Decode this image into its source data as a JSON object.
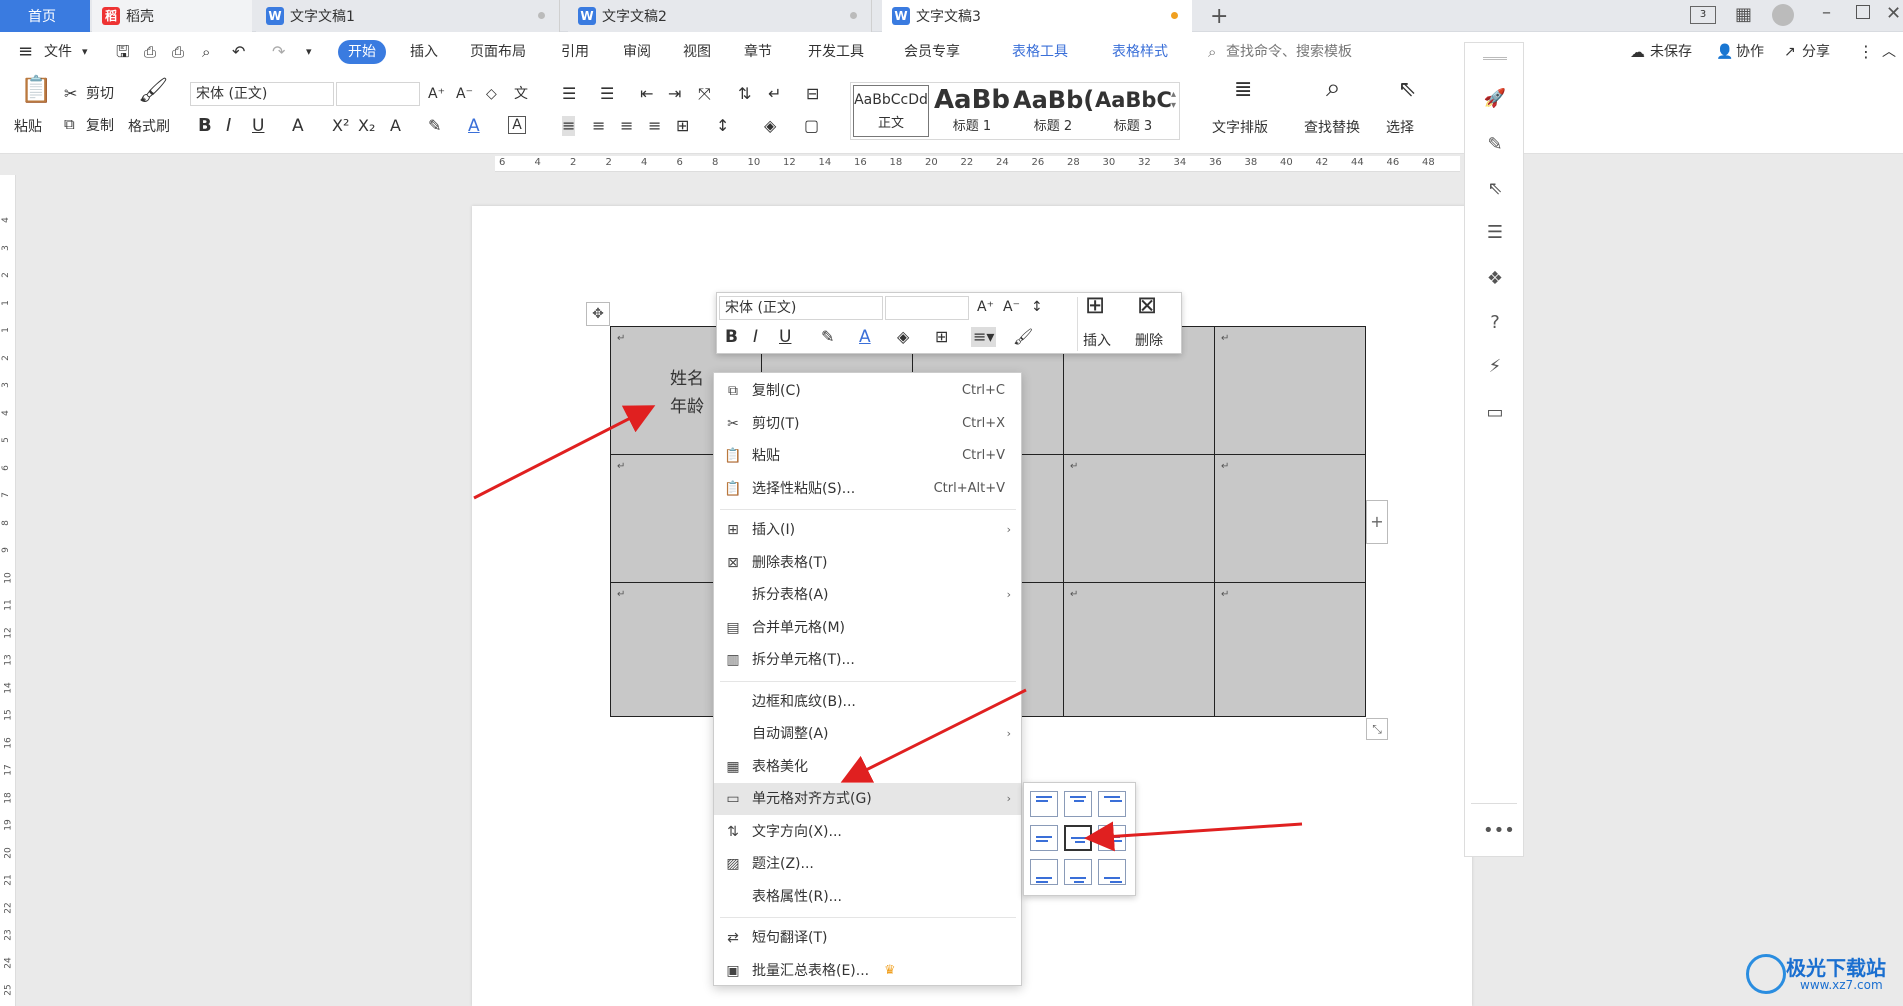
{
  "tabs": [
    {
      "label": "首页",
      "active": true
    },
    {
      "label": "稻壳"
    },
    {
      "label": "文字文稿1"
    },
    {
      "label": "文字文稿2"
    },
    {
      "label": "文字文稿3"
    }
  ],
  "new_tab": "+",
  "menu": {
    "file": "文件",
    "items": [
      "开始",
      "插入",
      "页面布局",
      "引用",
      "审阅",
      "视图",
      "章节",
      "开发工具",
      "会员专享"
    ],
    "table_tools": "表格工具",
    "table_style": "表格样式",
    "search": "查找命令、搜索模板",
    "unsaved": "未保存",
    "collab": "协作",
    "share": "分享"
  },
  "toolbar": {
    "paste": "粘贴",
    "cut": "剪切",
    "copy": "复制",
    "format_painter": "格式刷",
    "font": "宋体 (正文)",
    "font_size": "",
    "styles": [
      {
        "preview": "AaBbCcDd",
        "name": "正文"
      },
      {
        "preview": "AaBb",
        "name": "标题 1"
      },
      {
        "preview": "AaBb(",
        "name": "标题 2"
      },
      {
        "preview": "AaBbC",
        "name": "标题 3"
      }
    ],
    "text_layout": "文字排版",
    "find_replace": "查找替换",
    "select": "选择"
  },
  "ruler_labels": [
    "6",
    "4",
    "2",
    "2",
    "4",
    "6",
    "8",
    "10",
    "12",
    "14",
    "16",
    "18",
    "20",
    "22",
    "24",
    "26",
    "28",
    "30",
    "32",
    "34",
    "36",
    "38",
    "40",
    "42",
    "44",
    "46",
    "48"
  ],
  "vruler_labels": [
    "4",
    "3",
    "2",
    "1",
    "1",
    "2",
    "3",
    "4",
    "5",
    "6",
    "7",
    "8",
    "9",
    "10",
    "11",
    "12",
    "13",
    "14",
    "15",
    "16",
    "17",
    "18",
    "19",
    "20",
    "21",
    "22",
    "23",
    "24",
    "25"
  ],
  "doc": {
    "cell_text": [
      "姓名",
      "年龄"
    ],
    "mark": "↵"
  },
  "mini_toolbar": {
    "font": "宋体 (正文)",
    "size": "",
    "insert": "插入",
    "delete": "删除"
  },
  "context_menu": [
    {
      "icon": "copy-icon",
      "label": "复制(C)",
      "shortcut": "Ctrl+C"
    },
    {
      "icon": "cut-icon",
      "label": "剪切(T)",
      "shortcut": "Ctrl+X"
    },
    {
      "icon": "paste-icon",
      "label": "粘贴",
      "shortcut": "Ctrl+V"
    },
    {
      "icon": "paste-special-icon",
      "label": "选择性粘贴(S)...",
      "shortcut": "Ctrl+Alt+V"
    },
    {
      "icon": "table-insert-icon",
      "label": "插入(I)",
      "sub": true
    },
    {
      "icon": "table-delete-icon",
      "label": "删除表格(T)"
    },
    {
      "icon": "",
      "label": "拆分表格(A)",
      "sub": true
    },
    {
      "icon": "merge-cells-icon",
      "label": "合并单元格(M)"
    },
    {
      "icon": "split-cells-icon",
      "label": "拆分单元格(T)..."
    },
    {
      "icon": "",
      "label": "边框和底纹(B)..."
    },
    {
      "icon": "",
      "label": "自动调整(A)",
      "sub": true
    },
    {
      "icon": "table-beautify-icon",
      "label": "表格美化"
    },
    {
      "icon": "cell-align-icon",
      "label": "单元格对齐方式(G)",
      "sub": true,
      "highlight": true
    },
    {
      "icon": "text-direction-icon",
      "label": "文字方向(X)..."
    },
    {
      "icon": "caption-icon",
      "label": "题注(Z)..."
    },
    {
      "icon": "",
      "label": "表格属性(R)..."
    },
    {
      "icon": "translate-icon",
      "label": "短句翻译(T)"
    },
    {
      "icon": "batch-summary-icon",
      "label": "批量汇总表格(E)...",
      "crown": true
    }
  ],
  "watermark": {
    "name": "极光下载站",
    "url": "www.xz7.com"
  },
  "colors": {
    "accent": "#3a6fd8",
    "tab_active": "#3a7be0",
    "menu_pill": "#3a7be0",
    "arrow": "#e02020",
    "table_fill": "#c8c8c8",
    "highlight": "#e8e8e8"
  }
}
